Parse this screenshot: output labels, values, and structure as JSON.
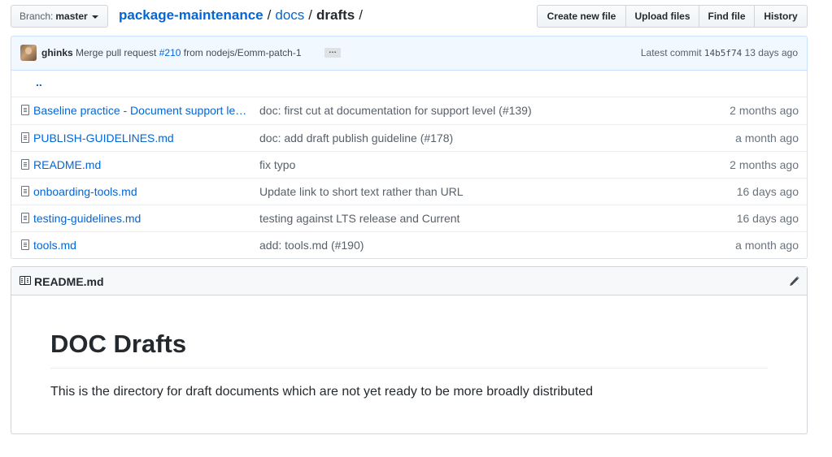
{
  "branch": {
    "label": "Branch:",
    "value": "master"
  },
  "breadcrumb": {
    "repo": "package-maintenance",
    "sep": "/",
    "docs": "docs",
    "current": "drafts"
  },
  "actions": {
    "create": "Create new file",
    "upload": "Upload files",
    "find": "Find file",
    "history": "History"
  },
  "commit": {
    "author": "ghinks",
    "message_prefix": "Merge pull request",
    "pr": "#210",
    "message_suffix": "from nodejs/Eomm-patch-1",
    "ellipsis": "…",
    "latest_label": "Latest commit",
    "sha": "14b5f74",
    "age": "13 days ago"
  },
  "files": {
    "parent": "..",
    "rows": [
      {
        "name": "Baseline practice - Document support level.md",
        "message": "doc: first cut at documentation for support level (#139)",
        "age": "2 months ago"
      },
      {
        "name": "PUBLISH-GUIDELINES.md",
        "message": "doc: add draft publish guideline (#178)",
        "age": "a month ago"
      },
      {
        "name": "README.md",
        "message": "fix typo",
        "age": "2 months ago"
      },
      {
        "name": "onboarding-tools.md",
        "message": "Update link to short text rather than URL",
        "age": "16 days ago"
      },
      {
        "name": "testing-guidelines.md",
        "message": "testing against LTS release and Current",
        "age": "16 days ago"
      },
      {
        "name": "tools.md",
        "message": "add: tools.md (#190)",
        "age": "a month ago"
      }
    ]
  },
  "readme": {
    "title": "README.md",
    "heading": "DOC Drafts",
    "paragraph": "This is the directory for draft documents which are not yet ready to be more broadly distributed"
  }
}
